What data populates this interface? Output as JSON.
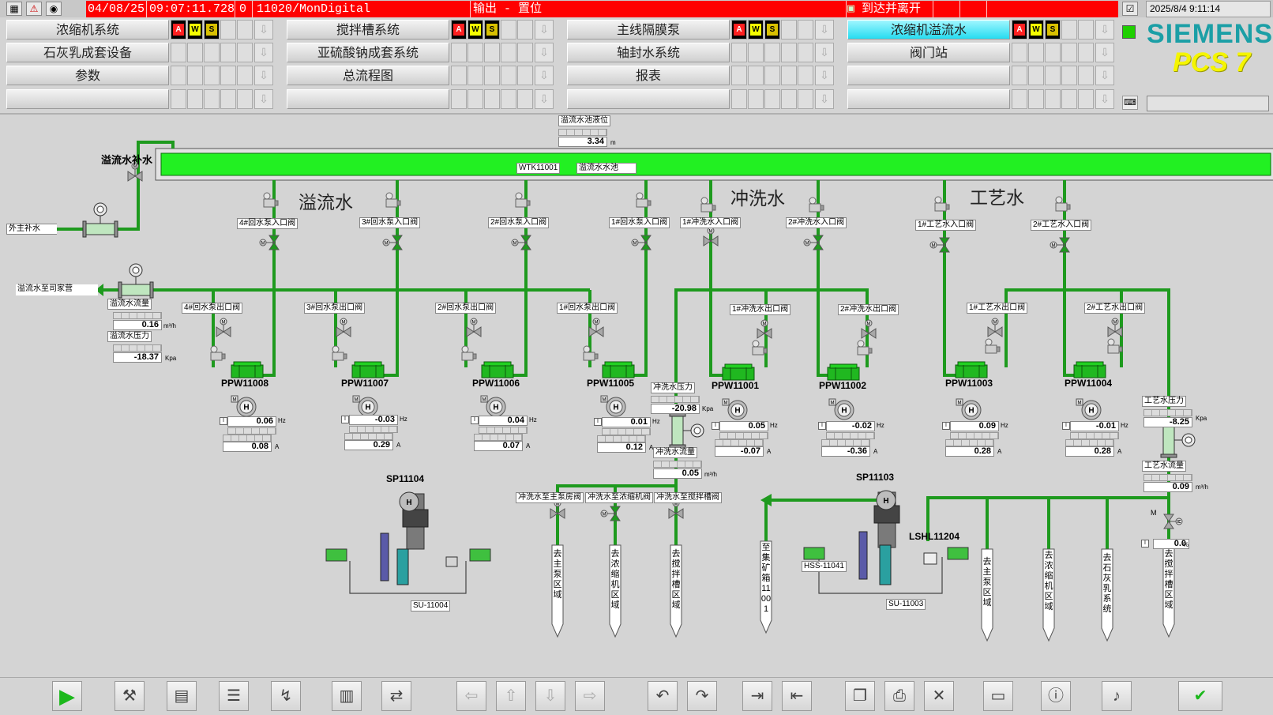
{
  "topbar": {
    "date": "04/08/25",
    "time": "09:07:11.728",
    "priority": "0",
    "source": "11020/MonDigital",
    "message": "输出 - 置位",
    "status": "到达并离开",
    "clock": "2025/8/4 9:11:14"
  },
  "nav": {
    "rows": [
      [
        "浓缩机系统",
        "搅拌槽系统",
        "主线隔膜泵",
        "浓缩机溢流水"
      ],
      [
        "石灰乳成套设备",
        "亚硫酸钠成套系统",
        "轴封水系统",
        "阀门站"
      ],
      [
        "参数",
        "总流程图",
        "报表",
        ""
      ],
      [
        "",
        "",
        "",
        ""
      ]
    ],
    "flags": [
      "A",
      "W",
      "S"
    ],
    "arrow": "⇩"
  },
  "brand": {
    "name": "SIEMENS",
    "product": "PCS 7"
  },
  "process": {
    "tank_level_label": "溢流水池液位",
    "tank_level_value": "3.34",
    "tank_level_unit": "m",
    "tank_tag": "WTK11001",
    "tank_name": "溢流水水池",
    "makeup_label": "溢流水补水",
    "makeup_source": "外主补水",
    "section_overflow": "溢流水",
    "section_flush": "冲洗水",
    "section_process": "工艺水",
    "overflow_to": "溢流水至司家营",
    "overflow_flow_label": "溢流水流量",
    "overflow_flow_value": "0.16",
    "overflow_flow_unit": "m³/h",
    "overflow_press_label": "溢流水压力",
    "overflow_press_value": "-18.37",
    "overflow_press_unit": "Kpa",
    "flush_press_label": "冲洗水压力",
    "flush_press_value": "-20.98",
    "flush_press_unit": "Kpa",
    "flush_flow_label": "冲洗水流量",
    "flush_flow_value": "0.05",
    "flush_flow_unit": "m³/h",
    "process_press_label": "工艺水压力",
    "process_press_value": "-8.25",
    "process_press_unit": "Kpa",
    "process_flow_label": "工艺水流量",
    "process_flow_value": "0.09",
    "process_flow_unit": "m³/h",
    "valve_pos_value": "0.0",
    "valve_pos_unit": "%",
    "valve_m": "M",
    "pump_symbol": "H",
    "indicator_i": "I",
    "hz": "Hz",
    "amp": "A",
    "pumps": [
      {
        "tag": "PPW11008",
        "inlet": "4#回水泵入口阀",
        "outlet": "4#回水泵出口阀",
        "hz": "0.06",
        "a": "0.08"
      },
      {
        "tag": "PPW11007",
        "inlet": "3#回水泵入口阀",
        "outlet": "3#回水泵出口阀",
        "hz": "-0.03",
        "a": "0.29"
      },
      {
        "tag": "PPW11006",
        "inlet": "2#回水泵入口阀",
        "outlet": "2#回水泵出口阀",
        "hz": "0.04",
        "a": "0.07"
      },
      {
        "tag": "PPW11005",
        "inlet": "1#回水泵入口阀",
        "outlet": "1#回水泵出口阀",
        "hz": "0.01",
        "a": "0.12"
      },
      {
        "tag": "PPW11001",
        "inlet": "1#冲洗水入口阀",
        "outlet": "1#冲洗水出口阀",
        "hz": "0.05",
        "a": "-0.07"
      },
      {
        "tag": "PPW11002",
        "inlet": "2#冲洗水入口阀",
        "outlet": "2#冲洗水出口阀",
        "hz": "-0.02",
        "a": "-0.36"
      },
      {
        "tag": "PPW11003",
        "inlet": "1#工艺水入口阀",
        "outlet": "1#工艺水出口阀",
        "hz": "0.09",
        "a": "0.28"
      },
      {
        "tag": "PPW11004",
        "inlet": "2#工艺水入口阀",
        "outlet": "2#工艺水出口阀",
        "hz": "-0.01",
        "a": "0.28"
      }
    ],
    "flush_valves": [
      "冲洗水至主泵房阀",
      "冲洗水至浓缩机阀",
      "冲洗水至搅拌槽阀"
    ],
    "flush_dest": [
      "去主泵区域",
      "去浓缩机区域",
      "去搅拌槽区域"
    ],
    "sump_pump_1": "SP11104",
    "sump_1": "SU-11004",
    "sump_pump_2": "SP11103",
    "sump_2": "SU-11003",
    "level_switch": "LSHL11204",
    "hss": "HSS-11041",
    "to_collect": "至集矿箱11001",
    "process_dest": [
      "去主泵区域",
      "去浓缩机区域",
      "去石灰乳系统",
      "去搅拌槽区域"
    ]
  },
  "colors": {
    "pipe": "#1e9a1e",
    "tank_fill": "#22f022",
    "alarm": "#ff0000"
  },
  "toolbar_icons": [
    "play-icon",
    "tool-icon",
    "notes-icon",
    "list-icon",
    "trend-icon",
    "thermometer-icon",
    "screen-switch-icon",
    "arrow-left-icon",
    "arrow-up-icon",
    "arrow-down-icon",
    "arrow-right-icon",
    "undo-icon",
    "redo-icon",
    "export-icon",
    "import-icon",
    "copy-window-icon",
    "print-icon",
    "delete-window-icon",
    "monitor-icon",
    "info-icon",
    "sound-icon",
    "acknowledge-icon"
  ]
}
